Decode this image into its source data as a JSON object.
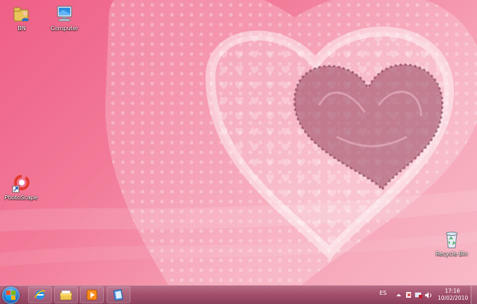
{
  "desktop": {
    "icons": [
      {
        "label": "BN",
        "icon": "user-folder-icon"
      },
      {
        "label": "Computer",
        "icon": "computer-icon"
      },
      {
        "label": "PhotoScape",
        "icon": "photoscape-icon"
      },
      {
        "label": "Recycle Bin",
        "icon": "recycle-bin-icon"
      }
    ]
  },
  "taskbar": {
    "start": {
      "icon": "windows-start-icon"
    },
    "pinned": [
      {
        "icon": "internet-explorer-icon"
      },
      {
        "icon": "file-explorer-icon"
      },
      {
        "icon": "media-player-icon"
      },
      {
        "icon": "notepad-icon"
      }
    ],
    "tray": {
      "language": "ES",
      "icons": [
        "show-hidden-icons-arrow-icon",
        "action-center-icon",
        "network-icon",
        "volume-icon"
      ]
    },
    "clock": {
      "time": "17:16",
      "date": "10/02/2010"
    }
  },
  "colors": {
    "wallpaper_pink": "#ef5f86",
    "wallpaper_light": "#f8b9c6",
    "taskbar": "#a3506d",
    "heart_dark": "#b5697e"
  }
}
